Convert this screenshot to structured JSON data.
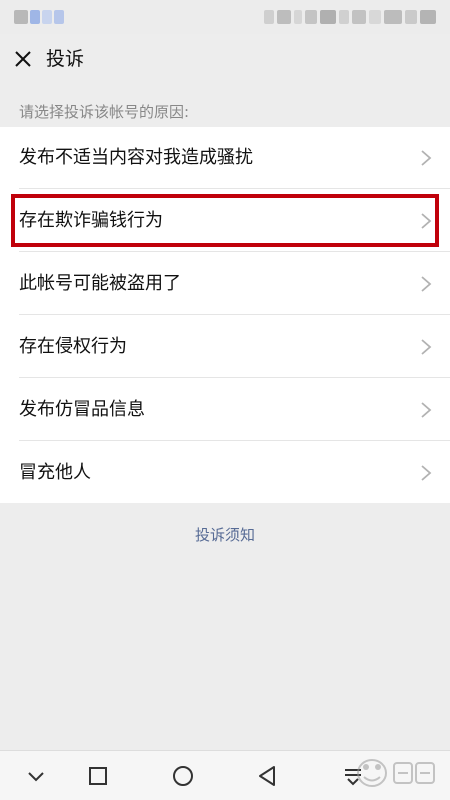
{
  "header": {
    "title": "投诉"
  },
  "prompt": "请选择投诉该帐号的原因:",
  "reasons": [
    {
      "label": "发布不适当内容对我造成骚扰"
    },
    {
      "label": "存在欺诈骗钱行为",
      "highlighted": true
    },
    {
      "label": "此帐号可能被盗用了"
    },
    {
      "label": "存在侵权行为"
    },
    {
      "label": "发布仿冒品信息"
    },
    {
      "label": "冒充他人"
    }
  ],
  "notice_link": "投诉须知",
  "colors": {
    "background": "#ededed",
    "link": "#576b95",
    "highlight_border": "#c0000a"
  },
  "navbar": {
    "icons": [
      "chevron-down-icon",
      "square-icon",
      "circle-icon",
      "triangle-back-icon",
      "notification-icon"
    ]
  }
}
